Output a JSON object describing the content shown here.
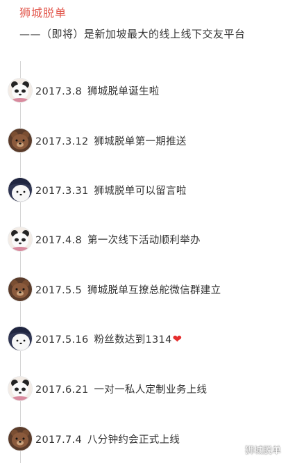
{
  "header": {
    "brand": "狮城脱单",
    "tagline": "——（即将）是新加坡最大的线上线下交友平台"
  },
  "timeline": [
    {
      "date": "2017.3.8",
      "text": "狮城脱单诞生啦",
      "avatar": "panda-avatar-icon"
    },
    {
      "date": "2017.3.12",
      "text": "狮城脱单第一期推送",
      "avatar": "brown-bear-avatar-icon"
    },
    {
      "date": "2017.3.31",
      "text": "狮城脱单可以留言啦",
      "avatar": "ice-bear-avatar-icon"
    },
    {
      "date": "2017.4.8",
      "text": "第一次线下活动顺利举办",
      "avatar": "panda-avatar-icon"
    },
    {
      "date": "2017.5.5",
      "text": "狮城脱单互撩总舵微信群建立",
      "avatar": "brown-bear-avatar-icon"
    },
    {
      "date": "2017.5.16",
      "text": "粉丝数达到1314",
      "avatar": "ice-bear-avatar-icon",
      "suffix_icon": "heart-icon"
    },
    {
      "date": "2017.6.21",
      "text": "一对一私人定制业务上线",
      "avatar": "panda-avatar-icon"
    },
    {
      "date": "2017.7.4",
      "text": "八分钟约会正式上线",
      "avatar": "brown-bear-avatar-icon"
    }
  ],
  "watermark": {
    "text": "狮城脱单",
    "icon": "wechat-icon"
  },
  "colors": {
    "brand": "#e2574c",
    "timeline_line": "#d4d4d4",
    "heart": "#e62e2e"
  }
}
